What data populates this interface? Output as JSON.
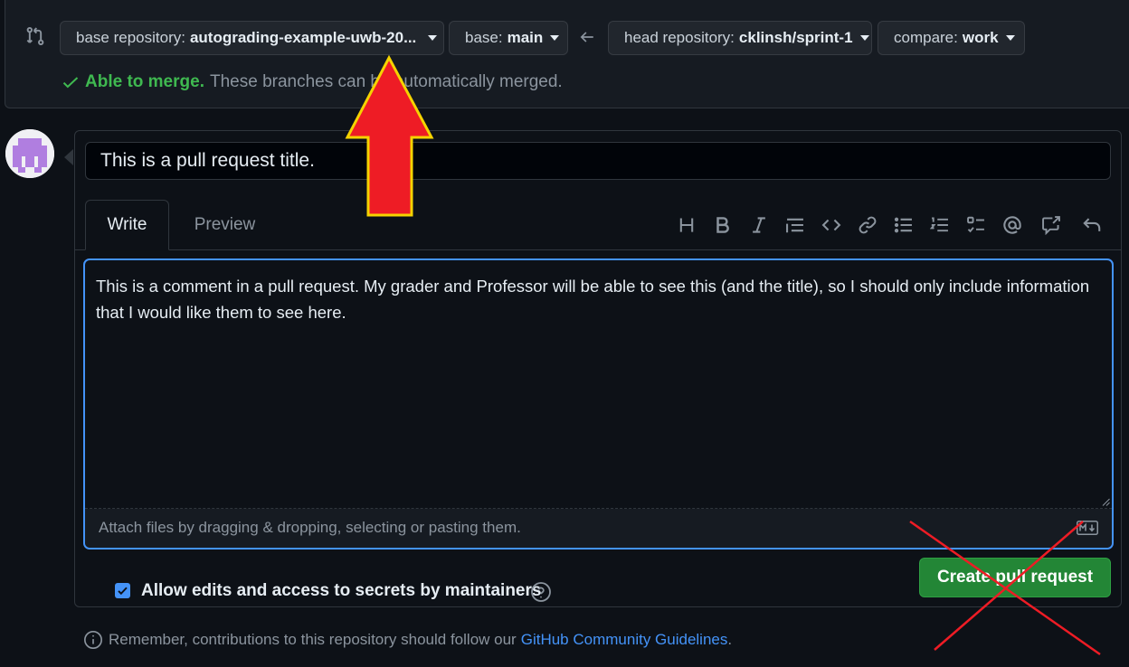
{
  "compare": {
    "base_repo_label": "base repository:",
    "base_repo_value": "autograding-example-uwb-20...",
    "base_label": "base:",
    "base_value": "main",
    "head_repo_label": "head repository:",
    "head_repo_value": "cklinsh/sprint-1",
    "compare_label": "compare:",
    "compare_value": "work",
    "merge_status": "Able to merge.",
    "merge_detail": "These branches can be automatically merged."
  },
  "form": {
    "title_value": "This is a pull request title.",
    "tabs": [
      "Write",
      "Preview"
    ],
    "comment_text": "This is a comment in a pull request. My grader and Professor will be able to see this (and the title), so I should only include information that I would like them to see here.",
    "attach_hint": "Attach files by dragging & dropping, selecting or pasting them.",
    "allow_edits_label": "Allow edits and access to secrets by maintainers",
    "create_button": "Create pull request"
  },
  "footer": {
    "remember_text": "Remember, contributions to this repository should follow our",
    "guidelines_link": "GitHub Community Guidelines",
    "period": "."
  },
  "colors": {
    "accent_blue": "#4493f8",
    "merge_green": "#3fb950",
    "button_green": "#238636",
    "annotation_red": "#ee1c25",
    "annotation_outline": "#f5d300"
  },
  "icons": {
    "toolbar": [
      "heading-icon",
      "bold-icon",
      "italic-icon",
      "quote-icon",
      "code-icon",
      "link-icon",
      "bulleted-list-icon",
      "numbered-list-icon",
      "task-list-icon",
      "mention-icon",
      "cross-reference-icon",
      "undo-icon"
    ]
  }
}
